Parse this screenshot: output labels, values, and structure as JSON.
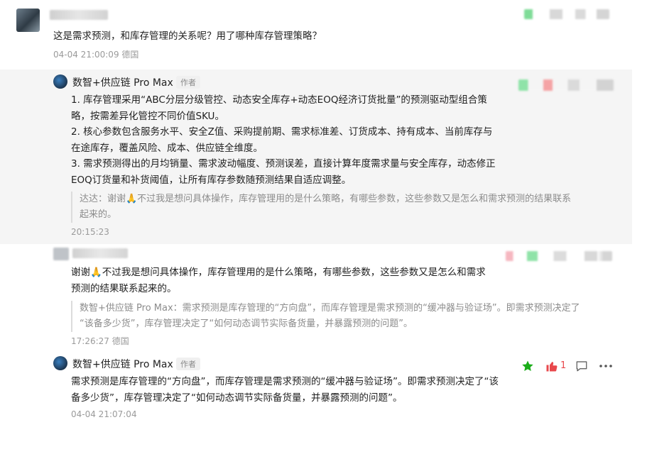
{
  "comment1": {
    "text": "这是需求预测，和库存管理的关系呢？用了哪种库存管理策略？",
    "meta": "04-04 21:00:09 德国"
  },
  "reply1": {
    "author": "数智+供应链 Pro Max",
    "badge": "作者",
    "lines": [
      "1. 库存管理采用“ABC分层分级管控、动态安全库存+动态EOQ经济订货批量”的预测驱动型组合策",
      "略，按需差异化管控不同价值SKU。",
      "2. 核心参数包含服务水平、安全Z值、采购提前期、需求标准差、订货成本、持有成本、当前库存与",
      "在途库存，覆盖风险、成本、供应链全维度。",
      "3. 需求预测得出的月均销量、需求波动幅度、预测误差，直接计算年度需求量与安全库存，动态修正",
      "EOQ订货量和补货阈值，让所有库存参数随预测结果自适应调整。"
    ],
    "quote_line1": "达达：谢谢🙏不过我是想问具体操作，库存管理用的是什么策略，有哪些参数，这些参数又是怎么和需求预测的结果联系",
    "quote_line2": "起来的。",
    "meta": "20:15:23"
  },
  "comment2": {
    "line1": "谢谢🙏不过我是想问具体操作，库存管理用的是什么策略，有哪些参数，这些参数又是怎么和需求",
    "line2": "预测的结果联系起来的。",
    "quote_line1": "数智+供应链 Pro Max：需求预测是库存管理的“方向盘”，而库存管理是需求预测的“缓冲器与验证场”。即需求预测决定了",
    "quote_line2": "“该备多少货”，库存管理决定了“如何动态调节实际备货量，并暴露预测的问题”。",
    "meta": "17:26:27 德国"
  },
  "reply2": {
    "author": "数智+供应链 Pro Max",
    "badge": "作者",
    "line1": "需求预测是库存管理的“方向盘”，而库存管理是需求预测的“缓冲器与验证场”。即需求预测决定了“该",
    "line2": "备多少货”，库存管理决定了“如何动态调节实际备货量，并暴露预测的问题”。",
    "meta": "04-04 21:07:04",
    "like_count": "1"
  },
  "icons": [
    "star-icon",
    "thumbs-up-icon",
    "comment-icon",
    "more-icon"
  ],
  "colors": {
    "star": "#1aad19",
    "like": "#e8484c",
    "panel": "#f5f5f5"
  }
}
